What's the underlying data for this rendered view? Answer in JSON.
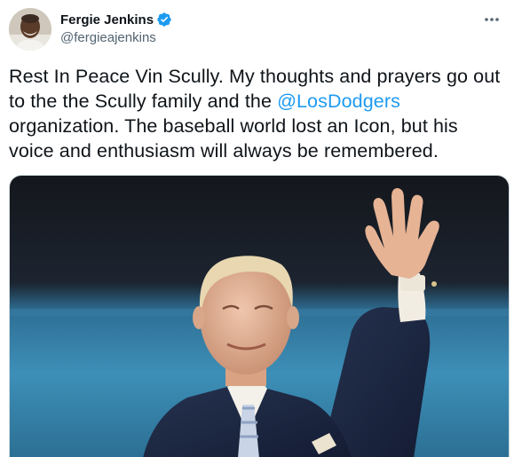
{
  "author": {
    "display_name": "Fergie Jenkins",
    "handle": "@fergieajenkins",
    "verified": true
  },
  "tweet": {
    "text_before": "Rest In Peace Vin Scully. My thoughts and prayers go out to the the Scully family and the ",
    "mention": "@LosDodgers",
    "text_after": " organization. The baseball world lost an Icon, but his voice and enthusiasm will always be remembered."
  },
  "icons": {
    "verified": "verified-badge-icon",
    "more": "more-options-icon"
  },
  "colors": {
    "accent": "#1d9bf0",
    "secondary_text": "#536471",
    "primary_text": "#0f1419"
  }
}
